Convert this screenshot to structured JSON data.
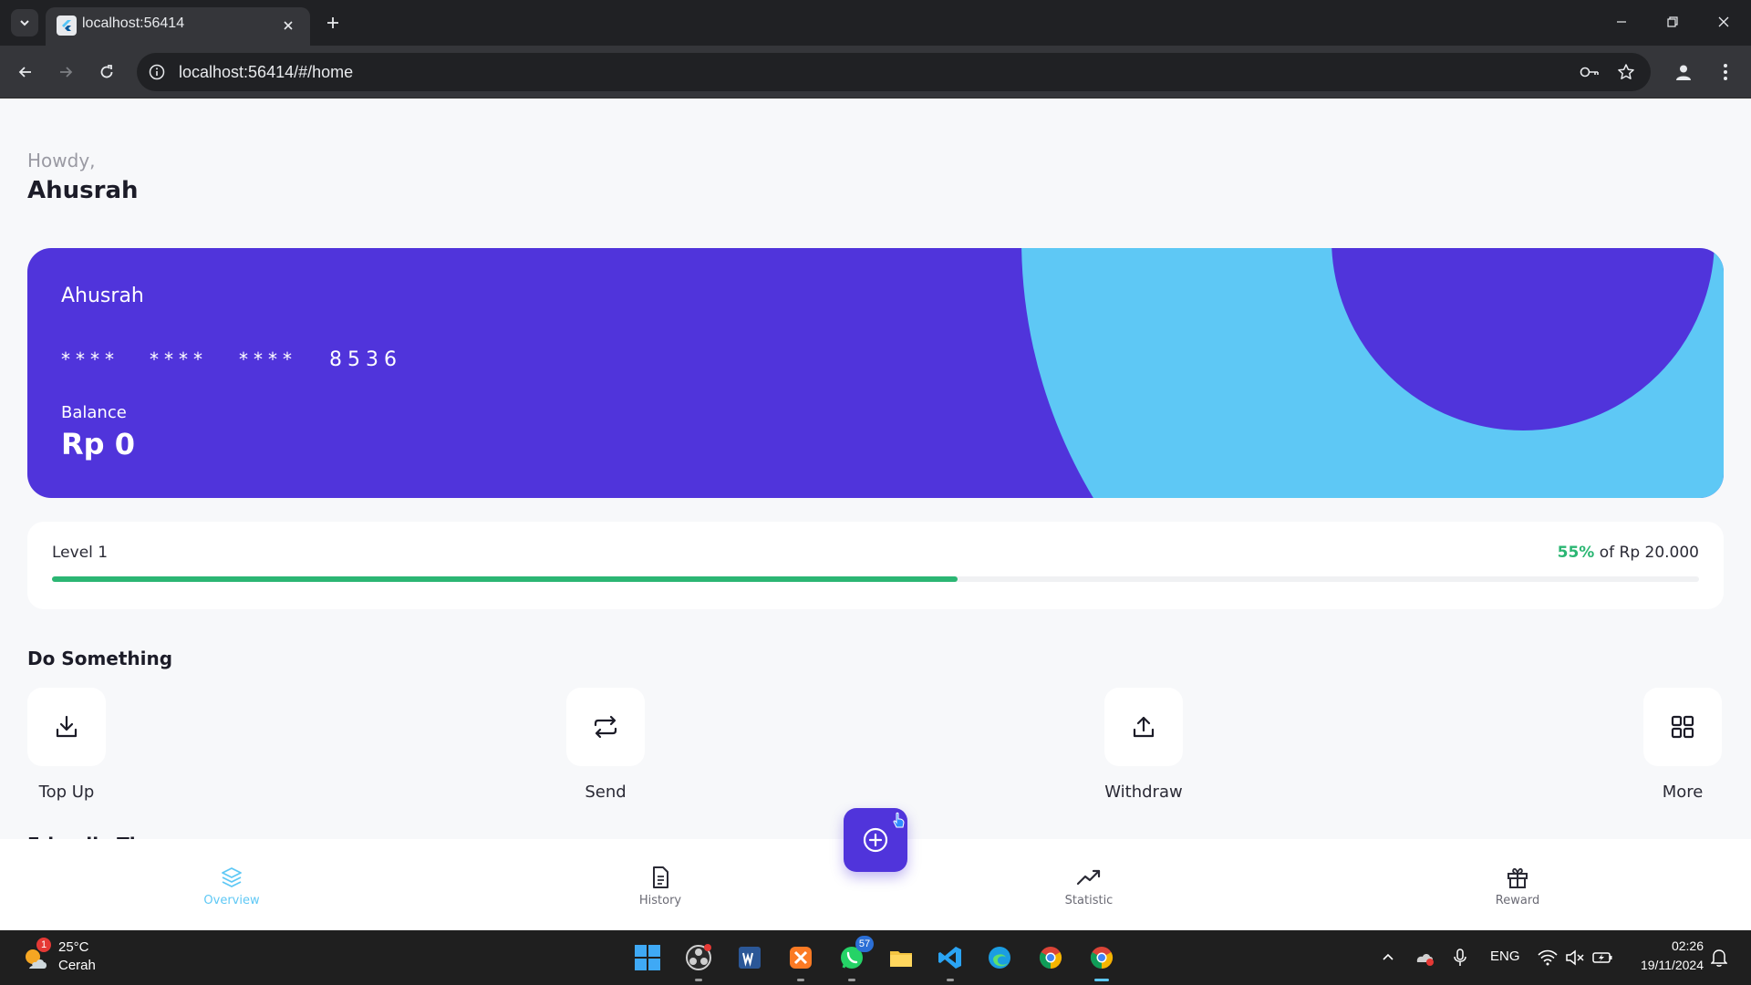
{
  "browser": {
    "tab_title": "localhost:56414",
    "url": "localhost:56414/#/home"
  },
  "app": {
    "greeting": "Howdy,",
    "user_name": "Ahusrah",
    "card": {
      "holder": "Ahusrah",
      "mask_groups": [
        "****",
        "****",
        "****"
      ],
      "last4": "8536",
      "balance_label": "Balance",
      "balance": "Rp 0"
    },
    "level": {
      "label": "Level 1",
      "percent_text": "55%",
      "target_text": "of Rp 20.000",
      "progress": 0.55
    },
    "actions_title": "Do Something",
    "actions": [
      {
        "label": "Top Up",
        "icon": "download-icon"
      },
      {
        "label": "Send",
        "icon": "repeat-icon"
      },
      {
        "label": "Withdraw",
        "icon": "upload-icon"
      },
      {
        "label": "More",
        "icon": "grid-icon"
      }
    ],
    "next_section_peek": "Friendly Tip",
    "bottom_nav": [
      {
        "label": "Overview",
        "icon": "layers-icon",
        "active": true
      },
      {
        "label": "History",
        "icon": "document-icon",
        "active": false
      },
      {
        "label": "Statistic",
        "icon": "trending-up-icon",
        "active": false
      },
      {
        "label": "Reward",
        "icon": "gift-icon",
        "active": false
      }
    ],
    "colors": {
      "primary": "#5034db",
      "accent": "#5ec8f5",
      "progress": "#2bb673",
      "background": "#f7f8fa"
    }
  },
  "taskbar": {
    "weather_badge": "1",
    "temperature": "25°C",
    "condition": "Cerah",
    "whatsapp_badge": "57",
    "language": "ENG",
    "time": "02:26",
    "date": "19/11/2024"
  }
}
